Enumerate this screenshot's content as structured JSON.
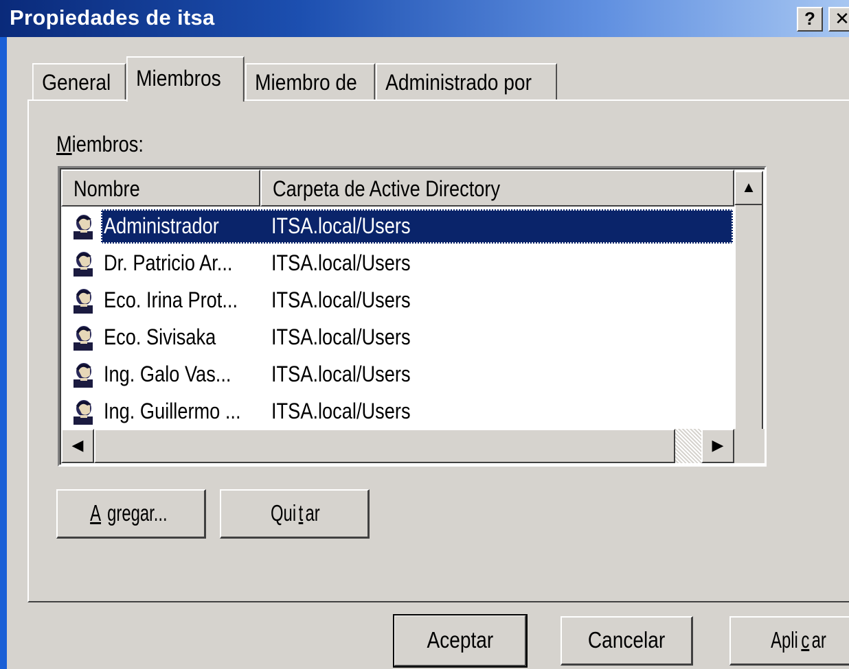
{
  "window": {
    "title": "Propiedades de itsa",
    "help_glyph": "?",
    "close_glyph": "✕"
  },
  "tabs": [
    {
      "label": "General"
    },
    {
      "label": "Miembros",
      "selected": true
    },
    {
      "label": "Miembro de"
    },
    {
      "label": "Administrado por"
    }
  ],
  "members": {
    "label_accel": "M",
    "label_rest": "iembros:",
    "columns": [
      "Nombre",
      "Carpeta de Active Directory"
    ],
    "rows": [
      {
        "name": "Administrador",
        "folder": "ITSA.local/Users",
        "selected": true
      },
      {
        "name": "Dr. Patricio Ar...",
        "folder": "ITSA.local/Users"
      },
      {
        "name": "Eco. Irina Prot...",
        "folder": "ITSA.local/Users"
      },
      {
        "name": "Eco. Sivisaka",
        "folder": "ITSA.local/Users"
      },
      {
        "name": "Ing. Galo Vas...",
        "folder": "ITSA.local/Users"
      },
      {
        "name": "Ing. Guillermo ...",
        "folder": "ITSA.local/Users"
      }
    ],
    "icon": "user-icon"
  },
  "buttons": {
    "agregar": {
      "accel": "A",
      "rest": "gregar..."
    },
    "quitar": {
      "pre": "Qui",
      "accel": "t",
      "rest": "ar"
    },
    "aceptar": "Aceptar",
    "cancelar": "Cancelar",
    "aplicar": {
      "pre": "Apli",
      "accel": "c",
      "rest": "ar"
    }
  },
  "colors": {
    "selection": "#0a246a",
    "face": "#d6d3ce"
  }
}
